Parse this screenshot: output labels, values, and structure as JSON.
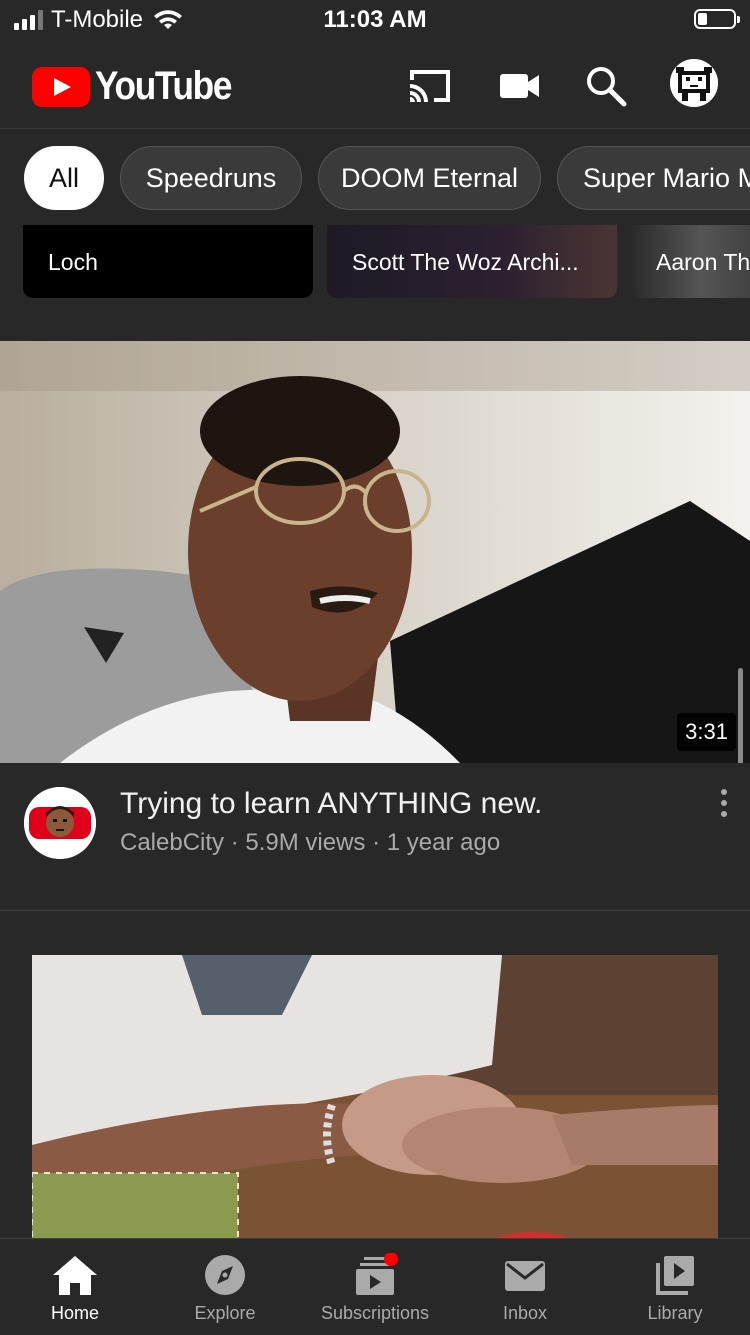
{
  "status_bar": {
    "carrier": "T-Mobile",
    "time": "11:03 AM"
  },
  "header": {
    "logo_text": "YouTube"
  },
  "chips": [
    {
      "label": "All",
      "active": true
    },
    {
      "label": "Speedruns"
    },
    {
      "label": "DOOM Eternal"
    },
    {
      "label": "Super Mario M"
    }
  ],
  "shelf": [
    {
      "label": "Loch"
    },
    {
      "label": "Scott The Woz Archi..."
    },
    {
      "label": "Aaron Th"
    }
  ],
  "video1": {
    "title": "Trying to learn ANYTHING new.",
    "channel": "CalebCity",
    "views": "5.9M views",
    "age": "1 year ago",
    "separator": " · ",
    "duration": "3:31"
  },
  "bottom_nav": [
    {
      "label": "Home",
      "icon": "home-icon",
      "active": true
    },
    {
      "label": "Explore",
      "icon": "compass-icon"
    },
    {
      "label": "Subscriptions",
      "icon": "subscriptions-icon"
    },
    {
      "label": "Inbox",
      "icon": "mail-icon"
    },
    {
      "label": "Library",
      "icon": "library-icon"
    }
  ],
  "colors": {
    "brand_red": "#ff0000",
    "background": "#282828",
    "notification_dot": "#ff0000"
  }
}
